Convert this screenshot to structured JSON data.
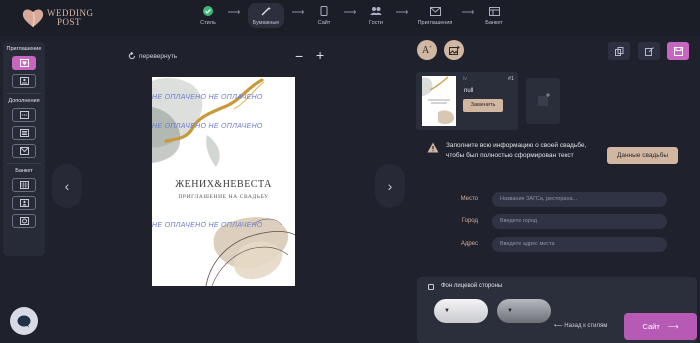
{
  "brand": {
    "line1": "WEDDING",
    "line2": "POST"
  },
  "steps": [
    {
      "label": "Стиль",
      "icon": "check-icon"
    },
    {
      "label": "Бумажные",
      "icon": "magic-wand-icon"
    },
    {
      "label": "Сайт",
      "icon": "phone-icon"
    },
    {
      "label": "Гости",
      "icon": "guests-icon"
    },
    {
      "label": "Приглашения",
      "icon": "envelope-icon"
    },
    {
      "label": "Банкет",
      "icon": "table-icon"
    }
  ],
  "sidebar": {
    "section1": "Приглашение",
    "section2": "Дополнения",
    "section3": "Банкет"
  },
  "canvas": {
    "rotate_label": "перевернуть",
    "watermark": "НЕ ОПЛАЧЕНО НЕ ОПЛАЧЕНО",
    "names": "ЖЕНИХ&НЕВЕСТА",
    "subtitle": "ПРИГЛАШЕНИЕ НА СВАДЬБУ"
  },
  "thumbnail": {
    "label": "tv",
    "number": "#1",
    "name": "null",
    "replace_label": "Заменить"
  },
  "notice": {
    "text": "Заполните всю информацию о своей свадьбе, чтобы был полностью сформирован текст",
    "button": "Данные свадьбы"
  },
  "form": {
    "place_label": "Место",
    "place_placeholder": "Название ЗАГСа, ресторана...",
    "city_label": "Город",
    "city_placeholder": "Введите город",
    "address_label": "Адрес",
    "address_placeholder": "Введите адрес места"
  },
  "background": {
    "label": "Фон лицевой стороны"
  },
  "footer": {
    "back_label": "Назад к стилям",
    "next_label": "Сайт"
  },
  "colors": {
    "accent": "#c766c0",
    "beige": "#d1b6a1",
    "bg": "#1f212c"
  }
}
